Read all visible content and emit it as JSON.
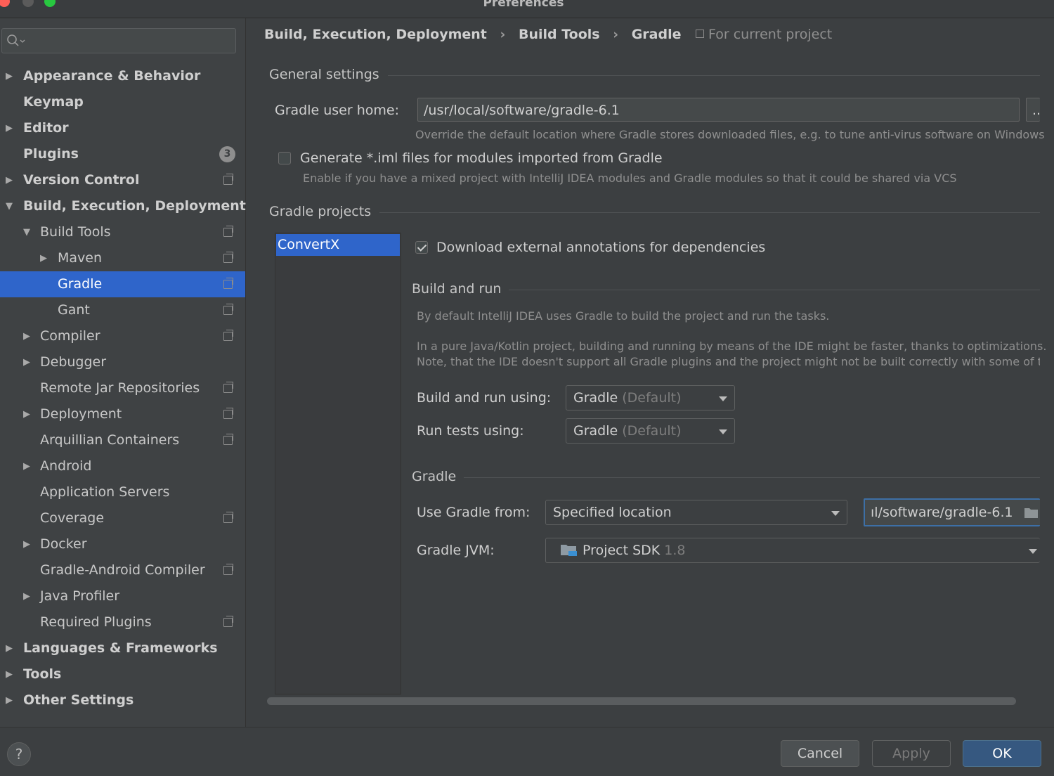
{
  "window": {
    "title": "Preferences",
    "traffic": {
      "close": "#fe5f57",
      "minimize": "#5b5b5b",
      "zoom": "#28c840"
    }
  },
  "sidebar": {
    "items": [
      {
        "label": "Appearance & Behavior",
        "level": 0,
        "arrow": "right",
        "icon": false
      },
      {
        "label": "Keymap",
        "level": 0,
        "arrow": "none",
        "icon": false
      },
      {
        "label": "Editor",
        "level": 0,
        "arrow": "right",
        "icon": false
      },
      {
        "label": "Plugins",
        "level": 0,
        "arrow": "none",
        "icon": false,
        "badge": "3"
      },
      {
        "label": "Version Control",
        "level": 0,
        "arrow": "right",
        "icon": true
      },
      {
        "label": "Build, Execution, Deployment",
        "level": 0,
        "arrow": "down",
        "icon": false
      },
      {
        "label": "Build Tools",
        "level": 1,
        "arrow": "down",
        "icon": true
      },
      {
        "label": "Maven",
        "level": 2,
        "arrow": "right",
        "icon": true
      },
      {
        "label": "Gradle",
        "level": 2,
        "arrow": "none",
        "icon": true,
        "selected": true
      },
      {
        "label": "Gant",
        "level": 2,
        "arrow": "none",
        "icon": true
      },
      {
        "label": "Compiler",
        "level": 1,
        "arrow": "right",
        "icon": true
      },
      {
        "label": "Debugger",
        "level": 1,
        "arrow": "right",
        "icon": false
      },
      {
        "label": "Remote Jar Repositories",
        "level": 1,
        "arrow": "none",
        "icon": true
      },
      {
        "label": "Deployment",
        "level": 1,
        "arrow": "right",
        "icon": true
      },
      {
        "label": "Arquillian Containers",
        "level": 1,
        "arrow": "none",
        "icon": true
      },
      {
        "label": "Android",
        "level": 1,
        "arrow": "right",
        "icon": false
      },
      {
        "label": "Application Servers",
        "level": 1,
        "arrow": "none",
        "icon": false
      },
      {
        "label": "Coverage",
        "level": 1,
        "arrow": "none",
        "icon": true
      },
      {
        "label": "Docker",
        "level": 1,
        "arrow": "right",
        "icon": false
      },
      {
        "label": "Gradle-Android Compiler",
        "level": 1,
        "arrow": "none",
        "icon": true
      },
      {
        "label": "Java Profiler",
        "level": 1,
        "arrow": "right",
        "icon": false
      },
      {
        "label": "Required Plugins",
        "level": 1,
        "arrow": "none",
        "icon": true
      },
      {
        "label": "Languages & Frameworks",
        "level": 0,
        "arrow": "right",
        "icon": false
      },
      {
        "label": "Tools",
        "level": 0,
        "arrow": "right",
        "icon": false
      },
      {
        "label": "Other Settings",
        "level": 0,
        "arrow": "right",
        "icon": false
      }
    ]
  },
  "breadcrumb": {
    "items": [
      "Build, Execution, Deployment",
      "Build Tools",
      "Gradle"
    ],
    "sep": "›",
    "scope": "For current project"
  },
  "general": {
    "title": "General settings",
    "home_label": "Gradle user home:",
    "home_value": "/usr/local/software/gradle-6.1",
    "browse": "..",
    "home_hint": "Override the default location where Gradle stores downloaded files, e.g. to tune anti-virus software on Windows",
    "iml_label": "Generate *.iml files for modules imported from Gradle",
    "iml_checked": false,
    "iml_hint": "Enable if you have a mixed project with IntelliJ IDEA modules and Gradle modules so that it could be shared via VCS"
  },
  "projects": {
    "title": "Gradle projects",
    "list": [
      "ConvertX"
    ],
    "download_label": "Download external annotations for dependencies",
    "download_checked": true,
    "build_run": {
      "title": "Build and run",
      "hint1": "By default IntelliJ IDEA uses Gradle to build the project and run the tasks.",
      "hint2": "In a pure Java/Kotlin project, building and running by means of the IDE might be faster, thanks to optimizations.",
      "hint3": "Note, that the IDE doesn't support all Gradle plugins and the project might not be built correctly with some of ther",
      "build_label": "Build and run using:",
      "build_value": "Gradle",
      "build_suffix": "(Default)",
      "tests_label": "Run tests using:",
      "tests_value": "Gradle",
      "tests_suffix": "(Default)"
    },
    "gradle": {
      "title": "Gradle",
      "from_label": "Use Gradle from:",
      "from_value": "Specified location",
      "path_value": "ıl/software/gradle-6.1",
      "jvm_label": "Gradle JVM:",
      "jvm_value": "Project SDK",
      "jvm_version": "1.8"
    }
  },
  "buttons": {
    "help": "?",
    "cancel": "Cancel",
    "apply": "Apply",
    "ok": "OK"
  }
}
